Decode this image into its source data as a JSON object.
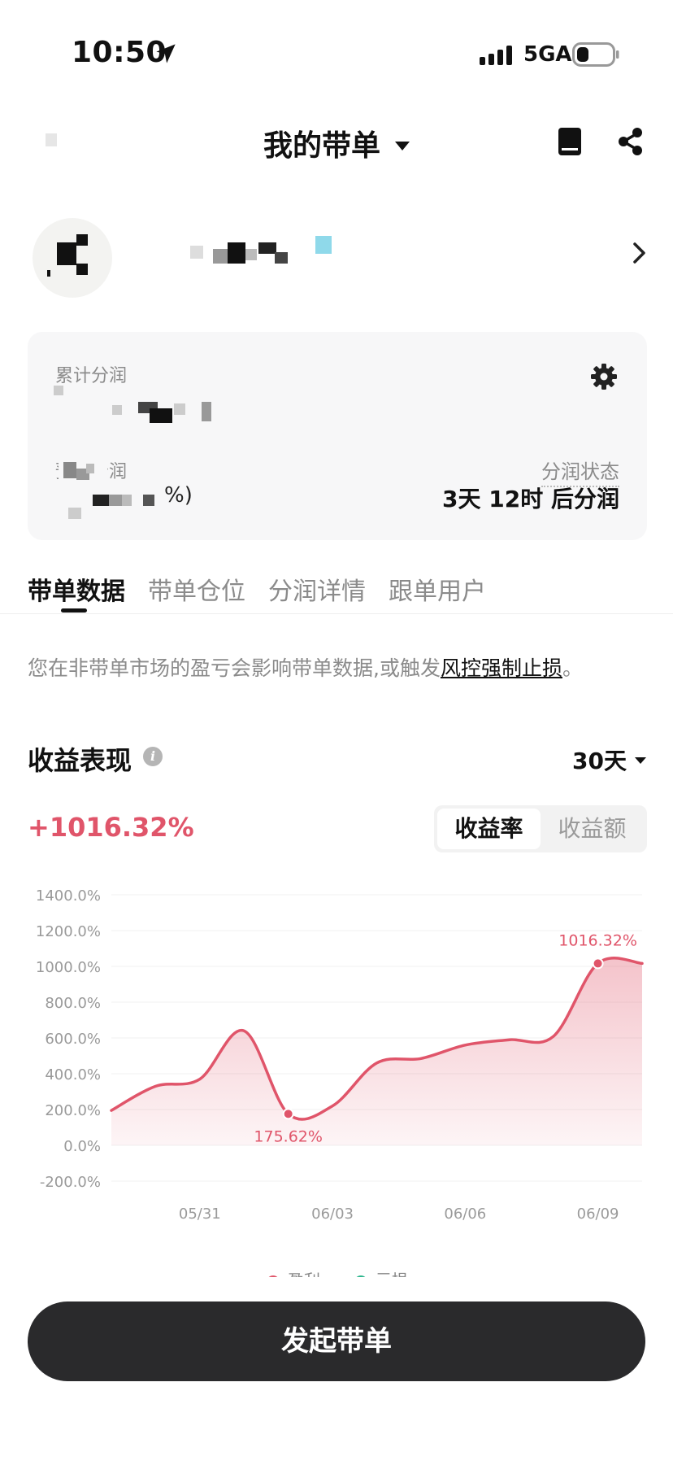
{
  "status_bar": {
    "time": "10:50",
    "network": "5GA"
  },
  "nav": {
    "title": "我的带单"
  },
  "card": {
    "total_label": "累计分润",
    "expected_label": "预计分润",
    "expected_tail": "%)",
    "status_label": "分润状态",
    "status_value": "3天 12时 后分润"
  },
  "tabs": [
    {
      "label": "带单数据"
    },
    {
      "label": "带单仓位"
    },
    {
      "label": "分润详情"
    },
    {
      "label": "跟单用户"
    }
  ],
  "notice": {
    "prefix": "您在非带单市场的盈亏会影响带单数据,或触发",
    "link": "风控强制止损",
    "suffix": "。"
  },
  "performance": {
    "title": "收益表现",
    "period": "30天",
    "value": "+1016.32%",
    "seg_rate": "收益率",
    "seg_amount": "收益额"
  },
  "chart_data": {
    "type": "area",
    "x": [
      "05/29",
      "05/30",
      "05/31",
      "06/01",
      "06/02",
      "06/03",
      "06/04",
      "06/05",
      "06/06",
      "06/07",
      "06/08",
      "06/09",
      "06/10"
    ],
    "series": [
      {
        "values": [
          195,
          330,
          370,
          640,
          175.62,
          220,
          460,
          485,
          560,
          590,
          610,
          1016.32,
          1016.32
        ]
      }
    ],
    "x_tick_labels": [
      "05/31",
      "06/03",
      "06/06",
      "06/09"
    ],
    "y_tick_labels": [
      "1400.0%",
      "1200.0%",
      "1000.0%",
      "800.0%",
      "600.0%",
      "400.0%",
      "200.0%",
      "0.0%",
      "-200.0%"
    ],
    "ylim": [
      -200,
      1400
    ],
    "annotations": [
      {
        "label": "175.62%"
      },
      {
        "label": "1016.32%"
      }
    ],
    "legend": [
      {
        "name": "盈利",
        "color": "#e0556a"
      },
      {
        "name": "亏损",
        "color": "#2bb58c"
      }
    ],
    "line_color": "#e0556a"
  },
  "cta": {
    "label": "发起带单"
  }
}
